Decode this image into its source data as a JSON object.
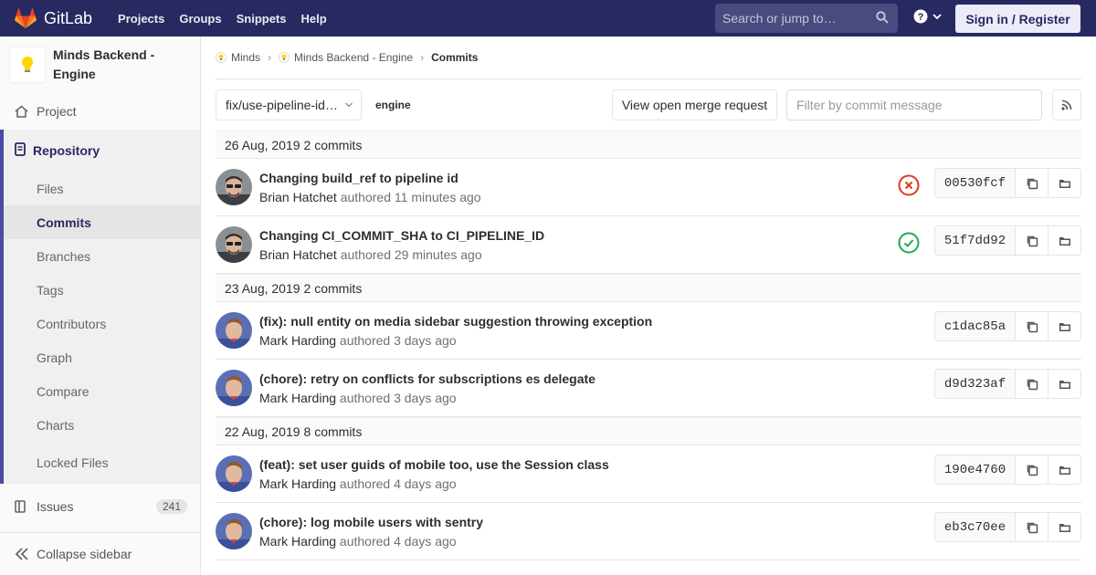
{
  "nav": {
    "brand": "GitLab",
    "links": [
      "Projects",
      "Groups",
      "Snippets",
      "Help"
    ],
    "search_placeholder": "Search or jump to…",
    "signin": "Sign in / Register"
  },
  "sidebar": {
    "project_name": "Minds Backend - Engine",
    "project": "Project",
    "repository": "Repository",
    "repo_items": [
      "Files",
      "Commits",
      "Branches",
      "Tags",
      "Contributors",
      "Graph",
      "Compare",
      "Charts",
      "Locked Files"
    ],
    "active_item": "Commits",
    "issues": "Issues",
    "issues_count": "241",
    "collapse": "Collapse sidebar"
  },
  "breadcrumb": {
    "group": "Minds",
    "project": "Minds Backend - Engine",
    "current": "Commits"
  },
  "toolbar": {
    "branch": "fix/use-pipeline-id…",
    "path": "engine",
    "mr_button": "View open merge request",
    "filter_placeholder": "Filter by commit message"
  },
  "groups": [
    {
      "date": "26 Aug, 2019",
      "count": "2 commits",
      "commits": [
        {
          "title": "Changing build_ref to pipeline id",
          "author": "Brian Hatchet",
          "verb": "authored",
          "time": "11 minutes ago",
          "status": "failed",
          "sha": "00530fcf",
          "avatar": "brian"
        },
        {
          "title": "Changing CI_COMMIT_SHA to CI_PIPELINE_ID",
          "author": "Brian Hatchet",
          "verb": "authored",
          "time": "29 minutes ago",
          "status": "passed",
          "sha": "51f7dd92",
          "avatar": "brian"
        }
      ]
    },
    {
      "date": "23 Aug, 2019",
      "count": "2 commits",
      "commits": [
        {
          "title": "(fix): null entity on media sidebar suggestion throwing exception",
          "author": "Mark Harding",
          "verb": "authored",
          "time": "3 days ago",
          "status": "",
          "sha": "c1dac85a",
          "avatar": "mark"
        },
        {
          "title": "(chore): retry on conflicts for subscriptions es delegate",
          "author": "Mark Harding",
          "verb": "authored",
          "time": "3 days ago",
          "status": "",
          "sha": "d9d323af",
          "avatar": "mark"
        }
      ]
    },
    {
      "date": "22 Aug, 2019",
      "count": "8 commits",
      "commits": [
        {
          "title": "(feat): set user guids of mobile too, use the Session class",
          "author": "Mark Harding",
          "verb": "authored",
          "time": "4 days ago",
          "status": "",
          "sha": "190e4760",
          "avatar": "mark"
        },
        {
          "title": "(chore): log mobile users with sentry",
          "author": "Mark Harding",
          "verb": "authored",
          "time": "4 days ago",
          "status": "",
          "sha": "eb3c70ee",
          "avatar": "mark"
        }
      ]
    }
  ],
  "colors": {
    "navbar": "#292961",
    "failed": "#db3b21",
    "passed": "#1aaa55"
  }
}
